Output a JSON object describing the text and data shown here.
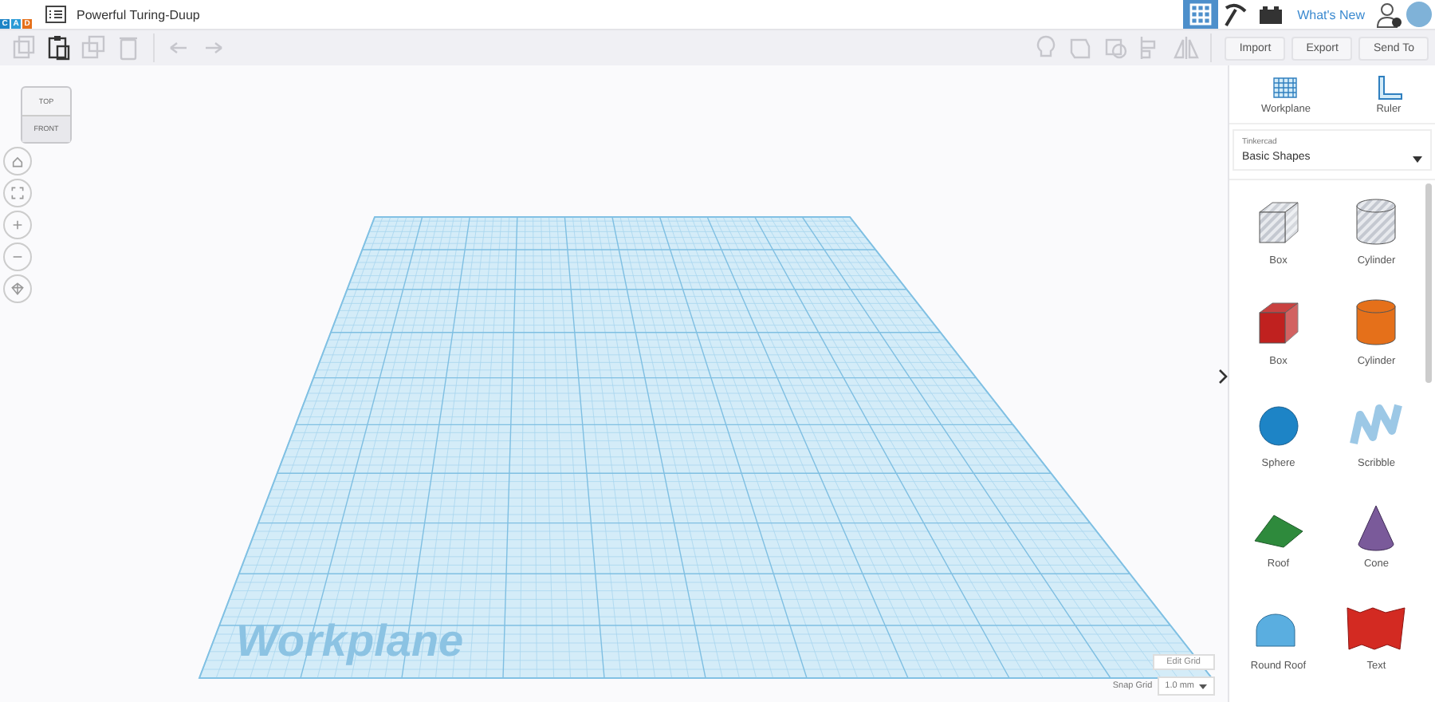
{
  "header": {
    "logo_letters": [
      "C",
      "A",
      "D"
    ],
    "title": "Powerful Turing-Duup",
    "views": [
      {
        "kind": "grid",
        "selected": true
      },
      {
        "kind": "pickaxe",
        "selected": false
      },
      {
        "kind": "bricks",
        "selected": false
      }
    ],
    "whats_new": "What's New"
  },
  "toolbar": {
    "edit_tools": [
      {
        "kind": "copy",
        "disabled": true
      },
      {
        "kind": "paste",
        "disabled": false
      },
      {
        "kind": "duplicate",
        "disabled": true
      },
      {
        "kind": "delete",
        "disabled": true
      },
      {
        "kind": "undo",
        "disabled": true
      },
      {
        "kind": "redo",
        "disabled": true
      }
    ],
    "shape_tools": [
      {
        "kind": "bulb",
        "disabled": true
      },
      {
        "kind": "group",
        "disabled": true
      },
      {
        "kind": "ungroup",
        "disabled": true
      },
      {
        "kind": "align",
        "disabled": true
      },
      {
        "kind": "mirror",
        "disabled": true
      }
    ],
    "actions": [
      "Import",
      "Export",
      "Send To"
    ]
  },
  "canvas": {
    "view_cube": {
      "top": "TOP",
      "front": "FRONT"
    },
    "nav_buttons": [
      {
        "kind": "home"
      },
      {
        "kind": "fit"
      },
      {
        "kind": "zoom-in"
      },
      {
        "kind": "zoom-out"
      },
      {
        "kind": "perspective"
      }
    ],
    "workplane_label": "Workplane",
    "edit_grid": "Edit Grid",
    "snap_label": "Snap Grid",
    "snap_value": "1.0 mm"
  },
  "panel": {
    "tools": [
      {
        "kind": "workplane",
        "label": "Workplane"
      },
      {
        "kind": "ruler",
        "label": "Ruler"
      }
    ],
    "library": {
      "label": "Tinkercad",
      "value": "Basic Shapes"
    },
    "shapes": [
      {
        "kind": "box",
        "label": "Box",
        "color": "#c4c8d0",
        "hole": true
      },
      {
        "kind": "cylinder",
        "label": "Cylinder",
        "color": "#c4c8d0",
        "hole": true
      },
      {
        "kind": "box",
        "label": "Box",
        "color": "#c0211f",
        "hole": false
      },
      {
        "kind": "cylinder",
        "label": "Cylinder",
        "color": "#e5701a",
        "hole": false
      },
      {
        "kind": "sphere",
        "label": "Sphere",
        "color": "#1d84c6",
        "hole": false
      },
      {
        "kind": "scribble",
        "label": "Scribble",
        "color": "#9cc8e6",
        "hole": false
      },
      {
        "kind": "roof",
        "label": "Roof",
        "color": "#2e8a3c",
        "hole": false
      },
      {
        "kind": "cone",
        "label": "Cone",
        "color": "#7a5a9a",
        "hole": false
      },
      {
        "kind": "round-roof",
        "label": "Round Roof",
        "color": "#5aaee0",
        "hole": false
      },
      {
        "kind": "text",
        "label": "Text",
        "color": "#d32a22",
        "hole": false
      }
    ]
  }
}
